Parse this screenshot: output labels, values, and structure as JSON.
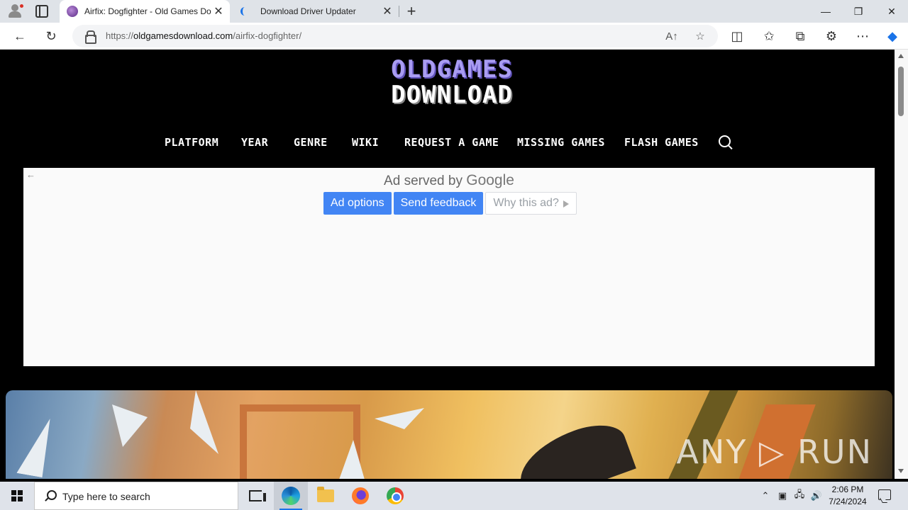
{
  "browser": {
    "tabs": [
      {
        "title": "Airfix: Dogfighter - Old Games Do",
        "close": "✕"
      },
      {
        "title": "Download Driver Updater",
        "close": "✕"
      }
    ],
    "new_tab": "+",
    "window_controls": {
      "minimize": "—",
      "restore": "❐",
      "close": "✕"
    },
    "url_prefix": "https://",
    "url_domain": "oldgamesdownload.com",
    "url_path": "/airfix-dogfighter/",
    "icons": {
      "back": "←",
      "refresh": "↻",
      "read_aloud": "A↑",
      "favorite": "☆",
      "split": "◫",
      "favorites": "✩",
      "collections": "⧉",
      "extensions": "⚙",
      "more": "⋯",
      "copilot": "◆"
    }
  },
  "site": {
    "logo_line1": "OLDGAMES",
    "logo_line2": "DOWNLOAD",
    "nav": [
      "PLATFORM",
      "YEAR",
      "GENRE",
      "WIKI",
      "REQUEST A GAME",
      "MISSING GAMES",
      "FLASH GAMES"
    ]
  },
  "ad": {
    "back": "←",
    "served_prefix": "Ad served by",
    "served_brand": "Google",
    "options": "Ad options",
    "feedback": "Send feedback",
    "why": "Why this ad?"
  },
  "watermark": "ANY ▷ RUN",
  "taskbar": {
    "search_placeholder": "Type here to search",
    "tray_icons": {
      "chevron": "⌃",
      "network": "🖧",
      "volume": "🔊"
    },
    "time": "2:06 PM",
    "date": "7/24/2024"
  },
  "colors": {
    "logo_purple": "#a99cf2",
    "ad_blue": "#4285f4",
    "page_bg": "#000000"
  }
}
